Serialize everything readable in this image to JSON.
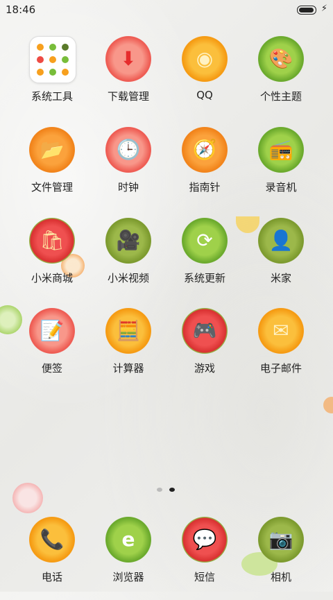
{
  "status_bar": {
    "time": "18:46"
  },
  "apps": [
    {
      "label": "系统工具",
      "icon": "folder-icon"
    },
    {
      "label": "下载管理",
      "icon": "download-arrow-icon"
    },
    {
      "label": "QQ",
      "icon": "qq-penguin-icon"
    },
    {
      "label": "个性主题",
      "icon": "palette-icon"
    },
    {
      "label": "文件管理",
      "icon": "folder-open-icon"
    },
    {
      "label": "时钟",
      "icon": "clock-icon"
    },
    {
      "label": "指南针",
      "icon": "compass-icon"
    },
    {
      "label": "录音机",
      "icon": "radio-icon"
    },
    {
      "label": "小米商城",
      "icon": "shopping-bag-icon"
    },
    {
      "label": "小米视频",
      "icon": "video-camera-icon"
    },
    {
      "label": "系统更新",
      "icon": "refresh-icon"
    },
    {
      "label": "米家",
      "icon": "head-profile-icon"
    },
    {
      "label": "便签",
      "icon": "notepad-icon"
    },
    {
      "label": "计算器",
      "icon": "calculator-icon"
    },
    {
      "label": "游戏",
      "icon": "gamepad-icon"
    },
    {
      "label": "电子邮件",
      "icon": "email-icon"
    }
  ],
  "dock": [
    {
      "label": "电话",
      "icon": "phone-icon"
    },
    {
      "label": "浏览器",
      "icon": "browser-e-icon"
    },
    {
      "label": "短信",
      "icon": "message-bubble-icon"
    },
    {
      "label": "相机",
      "icon": "camera-icon"
    }
  ],
  "colors": {
    "orange": "#f7a01e",
    "red": "#ee4b44",
    "green": "#78bd3a",
    "kiwi": "#8fae3a",
    "label": "#222222"
  }
}
